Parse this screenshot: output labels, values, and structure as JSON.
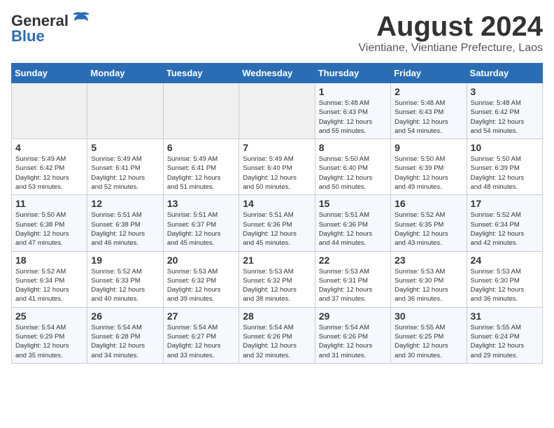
{
  "header": {
    "logo_general": "General",
    "logo_blue": "Blue",
    "title": "August 2024",
    "subtitle": "Vientiane, Vientiane Prefecture, Laos"
  },
  "weekdays": [
    "Sunday",
    "Monday",
    "Tuesday",
    "Wednesday",
    "Thursday",
    "Friday",
    "Saturday"
  ],
  "weeks": [
    [
      {
        "day": "",
        "info": ""
      },
      {
        "day": "",
        "info": ""
      },
      {
        "day": "",
        "info": ""
      },
      {
        "day": "",
        "info": ""
      },
      {
        "day": "1",
        "info": "Sunrise: 5:48 AM\nSunset: 6:43 PM\nDaylight: 12 hours\nand 55 minutes."
      },
      {
        "day": "2",
        "info": "Sunrise: 5:48 AM\nSunset: 6:43 PM\nDaylight: 12 hours\nand 54 minutes."
      },
      {
        "day": "3",
        "info": "Sunrise: 5:48 AM\nSunset: 6:42 PM\nDaylight: 12 hours\nand 54 minutes."
      }
    ],
    [
      {
        "day": "4",
        "info": "Sunrise: 5:49 AM\nSunset: 6:42 PM\nDaylight: 12 hours\nand 53 minutes."
      },
      {
        "day": "5",
        "info": "Sunrise: 5:49 AM\nSunset: 6:41 PM\nDaylight: 12 hours\nand 52 minutes."
      },
      {
        "day": "6",
        "info": "Sunrise: 5:49 AM\nSunset: 6:41 PM\nDaylight: 12 hours\nand 51 minutes."
      },
      {
        "day": "7",
        "info": "Sunrise: 5:49 AM\nSunset: 6:40 PM\nDaylight: 12 hours\nand 50 minutes."
      },
      {
        "day": "8",
        "info": "Sunrise: 5:50 AM\nSunset: 6:40 PM\nDaylight: 12 hours\nand 50 minutes."
      },
      {
        "day": "9",
        "info": "Sunrise: 5:50 AM\nSunset: 6:39 PM\nDaylight: 12 hours\nand 49 minutes."
      },
      {
        "day": "10",
        "info": "Sunrise: 5:50 AM\nSunset: 6:39 PM\nDaylight: 12 hours\nand 48 minutes."
      }
    ],
    [
      {
        "day": "11",
        "info": "Sunrise: 5:50 AM\nSunset: 6:38 PM\nDaylight: 12 hours\nand 47 minutes."
      },
      {
        "day": "12",
        "info": "Sunrise: 5:51 AM\nSunset: 6:38 PM\nDaylight: 12 hours\nand 46 minutes."
      },
      {
        "day": "13",
        "info": "Sunrise: 5:51 AM\nSunset: 6:37 PM\nDaylight: 12 hours\nand 45 minutes."
      },
      {
        "day": "14",
        "info": "Sunrise: 5:51 AM\nSunset: 6:36 PM\nDaylight: 12 hours\nand 45 minutes."
      },
      {
        "day": "15",
        "info": "Sunrise: 5:51 AM\nSunset: 6:36 PM\nDaylight: 12 hours\nand 44 minutes."
      },
      {
        "day": "16",
        "info": "Sunrise: 5:52 AM\nSunset: 6:35 PM\nDaylight: 12 hours\nand 43 minutes."
      },
      {
        "day": "17",
        "info": "Sunrise: 5:52 AM\nSunset: 6:34 PM\nDaylight: 12 hours\nand 42 minutes."
      }
    ],
    [
      {
        "day": "18",
        "info": "Sunrise: 5:52 AM\nSunset: 6:34 PM\nDaylight: 12 hours\nand 41 minutes."
      },
      {
        "day": "19",
        "info": "Sunrise: 5:52 AM\nSunset: 6:33 PM\nDaylight: 12 hours\nand 40 minutes."
      },
      {
        "day": "20",
        "info": "Sunrise: 5:53 AM\nSunset: 6:32 PM\nDaylight: 12 hours\nand 39 minutes."
      },
      {
        "day": "21",
        "info": "Sunrise: 5:53 AM\nSunset: 6:32 PM\nDaylight: 12 hours\nand 38 minutes."
      },
      {
        "day": "22",
        "info": "Sunrise: 5:53 AM\nSunset: 6:31 PM\nDaylight: 12 hours\nand 37 minutes."
      },
      {
        "day": "23",
        "info": "Sunrise: 5:53 AM\nSunset: 6:30 PM\nDaylight: 12 hours\nand 36 minutes."
      },
      {
        "day": "24",
        "info": "Sunrise: 5:53 AM\nSunset: 6:30 PM\nDaylight: 12 hours\nand 36 minutes."
      }
    ],
    [
      {
        "day": "25",
        "info": "Sunrise: 5:54 AM\nSunset: 6:29 PM\nDaylight: 12 hours\nand 35 minutes."
      },
      {
        "day": "26",
        "info": "Sunrise: 5:54 AM\nSunset: 6:28 PM\nDaylight: 12 hours\nand 34 minutes."
      },
      {
        "day": "27",
        "info": "Sunrise: 5:54 AM\nSunset: 6:27 PM\nDaylight: 12 hours\nand 33 minutes."
      },
      {
        "day": "28",
        "info": "Sunrise: 5:54 AM\nSunset: 6:26 PM\nDaylight: 12 hours\nand 32 minutes."
      },
      {
        "day": "29",
        "info": "Sunrise: 5:54 AM\nSunset: 6:26 PM\nDaylight: 12 hours\nand 31 minutes."
      },
      {
        "day": "30",
        "info": "Sunrise: 5:55 AM\nSunset: 6:25 PM\nDaylight: 12 hours\nand 30 minutes."
      },
      {
        "day": "31",
        "info": "Sunrise: 5:55 AM\nSunset: 6:24 PM\nDaylight: 12 hours\nand 29 minutes."
      }
    ]
  ]
}
